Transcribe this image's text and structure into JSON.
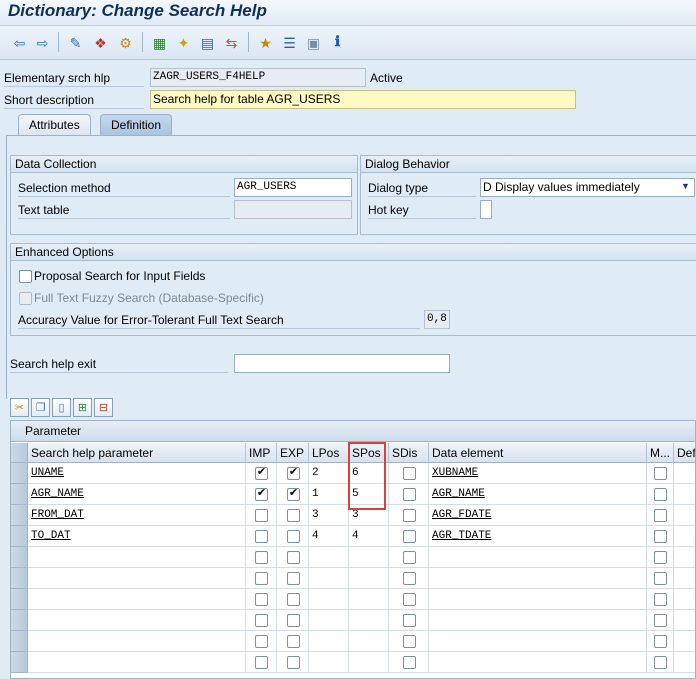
{
  "window": {
    "title": "Dictionary: Change Search Help"
  },
  "toolbar": {
    "icons": [
      "back-arrow-icon",
      "forward-arrow-icon",
      "display-change-icon",
      "other-object-icon",
      "activate-icon",
      "check-icon",
      "where-used-icon",
      "object-list-icon",
      "navigation-window-icon",
      "hierarchy-icon",
      "structure-icon",
      "documentation-icon",
      "info-icon"
    ]
  },
  "header": {
    "elementary_label": "Elementary srch hlp",
    "elementary_value": "ZAGR_USERS_F4HELP",
    "status": "Active",
    "short_desc_label": "Short description",
    "short_desc_value": "Search help for table AGR_USERS"
  },
  "tabs": [
    {
      "label": "Attributes"
    },
    {
      "label": "Definition"
    }
  ],
  "data_collection": {
    "title": "Data Collection",
    "selection_method_label": "Selection method",
    "selection_method_value": "AGR_USERS",
    "text_table_label": "Text table",
    "text_table_value": ""
  },
  "dialog_behavior": {
    "title": "Dialog Behavior",
    "dialog_type_label": "Dialog type",
    "dialog_type_value": "D Display values immediately",
    "hot_key_label": "Hot key",
    "hot_key_value": ""
  },
  "enhanced": {
    "title": "Enhanced Options",
    "proposal_label": "Proposal Search for Input Fields",
    "fulltext_label": "Full Text Fuzzy Search (Database-Specific)",
    "accuracy_label": "Accuracy Value for Error-Tolerant Full Text Search",
    "accuracy_value": "0,8"
  },
  "exit": {
    "label": "Search help exit",
    "value": ""
  },
  "parameter_table": {
    "title": "Parameter",
    "columns": [
      "Search help parameter",
      "IMP",
      "EXP",
      "LPos",
      "SPos",
      "SDis",
      "Data element",
      "M...",
      "Defa"
    ],
    "rows": [
      {
        "param": "UNAME",
        "imp": true,
        "exp": true,
        "lpos": "2",
        "spos": "6",
        "sdis": false,
        "element": "XUBNAME",
        "m": false
      },
      {
        "param": "AGR_NAME",
        "imp": true,
        "exp": true,
        "lpos": "1",
        "spos": "5",
        "sdis": false,
        "element": "AGR_NAME",
        "m": false
      },
      {
        "param": "FROM_DAT",
        "imp": false,
        "exp": false,
        "lpos": "3",
        "spos": "3",
        "sdis": false,
        "element": "AGR_FDATE",
        "m": false
      },
      {
        "param": "TO_DAT",
        "imp": false,
        "exp": false,
        "lpos": "4",
        "spos": "4",
        "sdis": false,
        "element": "AGR_TDATE",
        "m": false
      }
    ],
    "empty_rows": 6
  },
  "colors": {
    "highlight": "#d9423c",
    "background": "#dfebf5"
  }
}
